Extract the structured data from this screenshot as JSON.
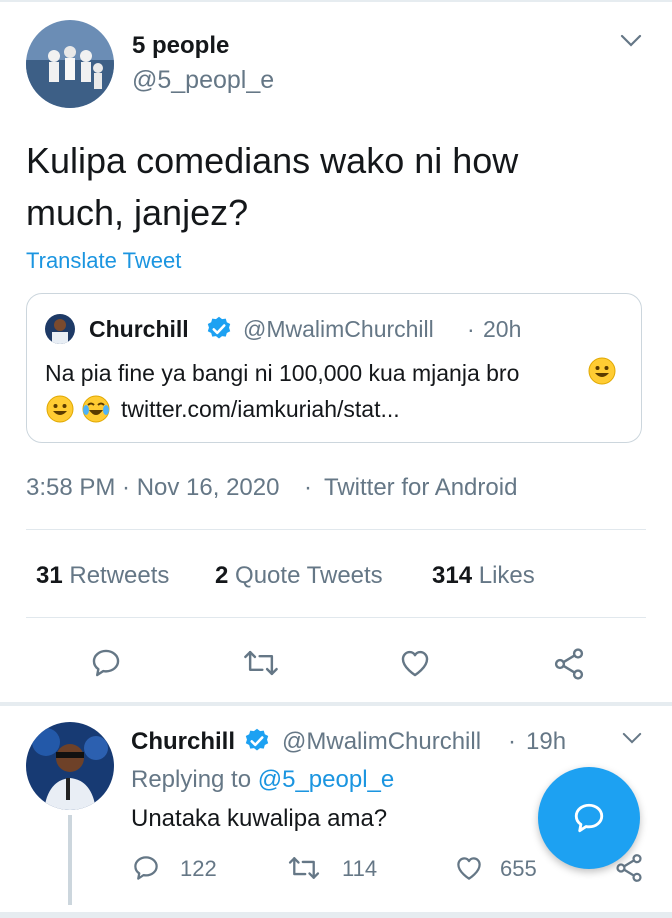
{
  "tweet": {
    "author_name": "5 people",
    "author_handle": "@5_peopl_e",
    "text_line1": "Kulipa comedians wako ni how",
    "text_line2": "much, janjez?",
    "translate_label": "Translate Tweet",
    "quoted": {
      "author_name": "Churchill",
      "author_handle": "@MwalimChurchill",
      "separator": "·",
      "time": "20h",
      "text_line1": "Na pia fine ya bangi ni 100,000 kua mjanja bro",
      "link": "twitter.com/iamkuriah/stat...",
      "emojis_line1": [
        "grinning-face"
      ],
      "emojis_line2": [
        "grinning-face",
        "crying-laughing-face"
      ]
    },
    "timestamp": "3:58 PM · Nov 16, 2020",
    "sep": "·",
    "client": "Twitter for Android",
    "stats": {
      "retweets_count": "31",
      "retweets_label": "Retweets",
      "quotes_count": "2",
      "quotes_label": "Quote Tweets",
      "likes_count": "314",
      "likes_label": "Likes"
    },
    "actions": [
      "reply-icon",
      "retweet-icon",
      "like-icon",
      "share-icon"
    ]
  },
  "reply": {
    "author_name": "Churchill",
    "author_handle": "@MwalimChurchill",
    "separator": "·",
    "time": "19h",
    "replying_prefix": "Replying to",
    "replying_to": "@5_peopl_e",
    "text": "Unataka kuwalipa ama?",
    "reply_count": "122",
    "retweet_count": "114",
    "like_count": "655"
  },
  "colors": {
    "accent": "#1b95e0",
    "fab": "#1da1f2",
    "text": "#14171a",
    "secondary": "#657786",
    "divider": "#e1e8ed"
  }
}
